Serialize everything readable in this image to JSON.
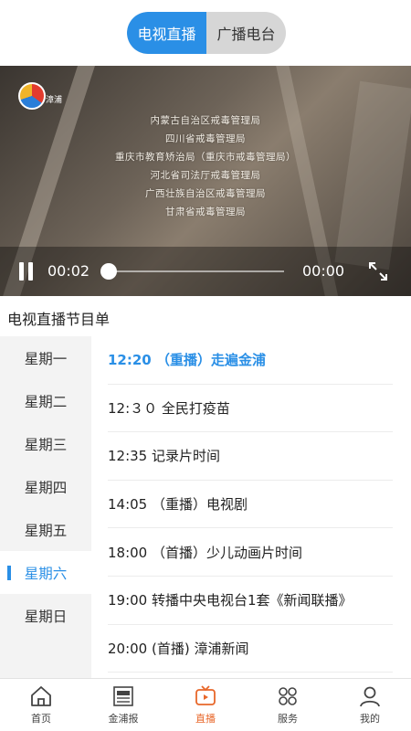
{
  "tabs": [
    {
      "label": "电视直播",
      "active": true
    },
    {
      "label": "广播电台",
      "active": false
    }
  ],
  "video": {
    "logo_text": "漳浦",
    "credits": [
      "内蒙古自治区戒毒管理局",
      "四川省戒毒管理局",
      "重庆市教育矫治局（重庆市戒毒管理局）",
      "河北省司法厅戒毒管理局",
      "广西壮族自治区戒毒管理局",
      "甘肃省戒毒管理局"
    ],
    "current_time": "00:02",
    "duration": "00:00",
    "progress": 0
  },
  "guide": {
    "title": "电视直播节目单",
    "days": [
      {
        "label": "星期一"
      },
      {
        "label": "星期二"
      },
      {
        "label": "星期三"
      },
      {
        "label": "星期四"
      },
      {
        "label": "星期五"
      },
      {
        "label": "星期六",
        "active": true
      },
      {
        "label": "星期日"
      }
    ],
    "programs": [
      {
        "text": "12:20 （重播）走遍金浦",
        "current": true
      },
      {
        "text": "12:３０ 全民打疫苗"
      },
      {
        "text": "12:35 记录片时间"
      },
      {
        "text": "14:05 （重播）电视剧"
      },
      {
        "text": "18:00 （首播）少儿动画片时间"
      },
      {
        "text": "19:00 转播中央电视台1套《新闻联播》"
      },
      {
        "text": "20:00 (首播) 漳浦新闻"
      }
    ]
  },
  "nav": [
    {
      "label": "首页",
      "icon": "home-icon"
    },
    {
      "label": "金浦报",
      "icon": "newspaper-icon"
    },
    {
      "label": "直播",
      "icon": "tv-icon",
      "active": true
    },
    {
      "label": "服务",
      "icon": "grid-icon"
    },
    {
      "label": "我的",
      "icon": "user-icon"
    }
  ],
  "colors": {
    "accent": "#2a8fe6",
    "nav_active": "#e8672a",
    "sidebar_bg": "#f3f3f3"
  }
}
